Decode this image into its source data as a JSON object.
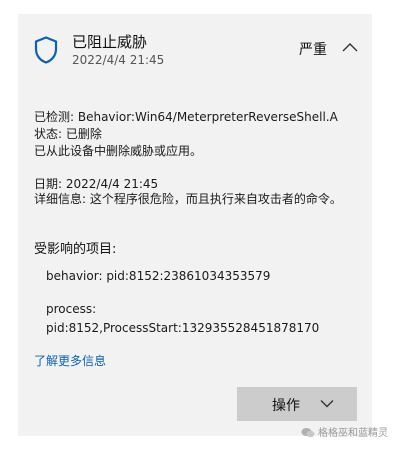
{
  "header": {
    "status_icon": "shield-icon",
    "title": "已阻止威胁",
    "date": "2022/4/4 21:45",
    "severity": "严重",
    "collapse_icon": "chevron-up-icon"
  },
  "detection": {
    "detected": "已检测: Behavior:Win64/MeterpreterReverseShell.A",
    "status": "状态: 已删除",
    "message": "已从此设备中删除威胁或应用。"
  },
  "details": {
    "date_line": "日期:  2022/4/4 21:45",
    "info_line": "详细信息: 这个程序很危险，而且执行来自攻击者的命令。"
  },
  "affected": {
    "heading": "受影响的项目:",
    "items": [
      "behavior: pid:8152:23861034353579",
      "process: pid:8152,ProcessStart:132935528451878170"
    ]
  },
  "links": {
    "learn_more": "了解更多信息"
  },
  "actions": {
    "label": "操作",
    "icon": "chevron-down-icon"
  },
  "watermark": {
    "text": "格格巫和蓝精灵",
    "icon": "wechat-icon"
  },
  "colors": {
    "card_bg": "#f2f2f2",
    "accent_blue": "#0b62b5",
    "button_bg": "#cccccc"
  }
}
